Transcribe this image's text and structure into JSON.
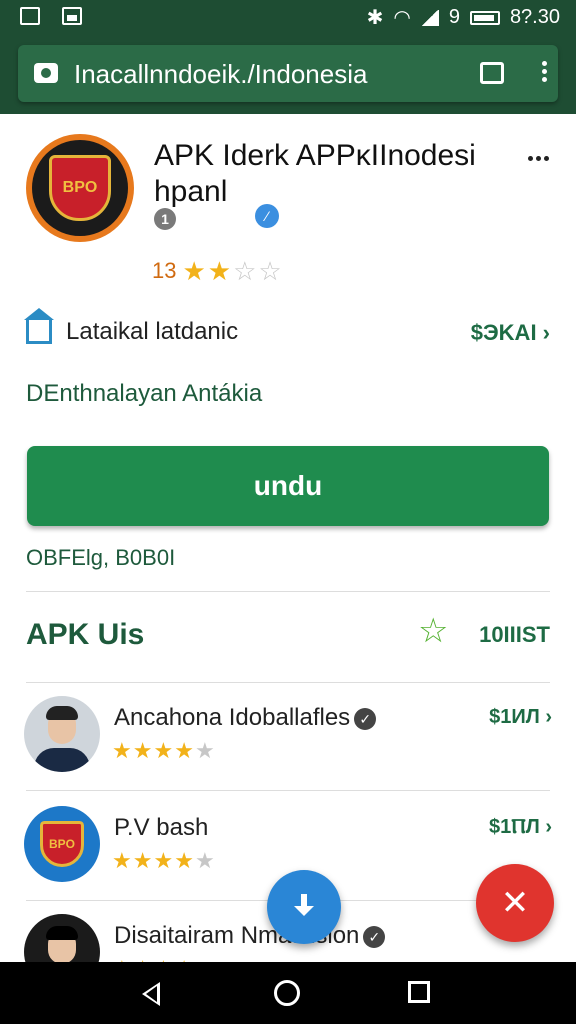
{
  "status_bar": {
    "time": "8?.30",
    "battery_text": "9",
    "icons": [
      "screenshot-icon",
      "gallery-icon",
      "bluetooth-icon",
      "wifi-icon",
      "signal-icon",
      "battery-icon"
    ]
  },
  "browser": {
    "url": "Inacallnndoeik./Indonesia",
    "icons": [
      "camera-icon",
      "tabs-icon",
      "overflow-menu-icon"
    ]
  },
  "app": {
    "title": "APK Iderk APPκIInodesi hpanl",
    "grey_badge": "1",
    "blue_badge": "⁄",
    "rating_value": "13",
    "rating_stars": 2.5,
    "info_label": "Lataikal latdanic",
    "info_price": "$ЭKAI ›",
    "developer": "DEnthnalayan Antákia",
    "install_label": "undu",
    "offer_text": "OBFElg, B0B0I"
  },
  "section": {
    "title": "APK Uis",
    "link": "10IIIST"
  },
  "list": [
    {
      "name": "Ancahona Idoballafles",
      "price": "$1ИЛ ›",
      "stars": 4,
      "verified": true,
      "avatar": "person"
    },
    {
      "name": "P.V bash",
      "price": "$1ⲠЛ ›",
      "stars": 4,
      "verified": false,
      "avatar": "logo"
    },
    {
      "name": "Disaitairam Nmatsision",
      "price": "",
      "stars": 4,
      "verified": true,
      "avatar": "dark"
    }
  ],
  "colors": {
    "header": "#1e4d33",
    "accent_green": "#1f8c4e",
    "star": "#f2b21a",
    "fab_blue": "#2a86d6",
    "fab_red": "#e0342e"
  }
}
